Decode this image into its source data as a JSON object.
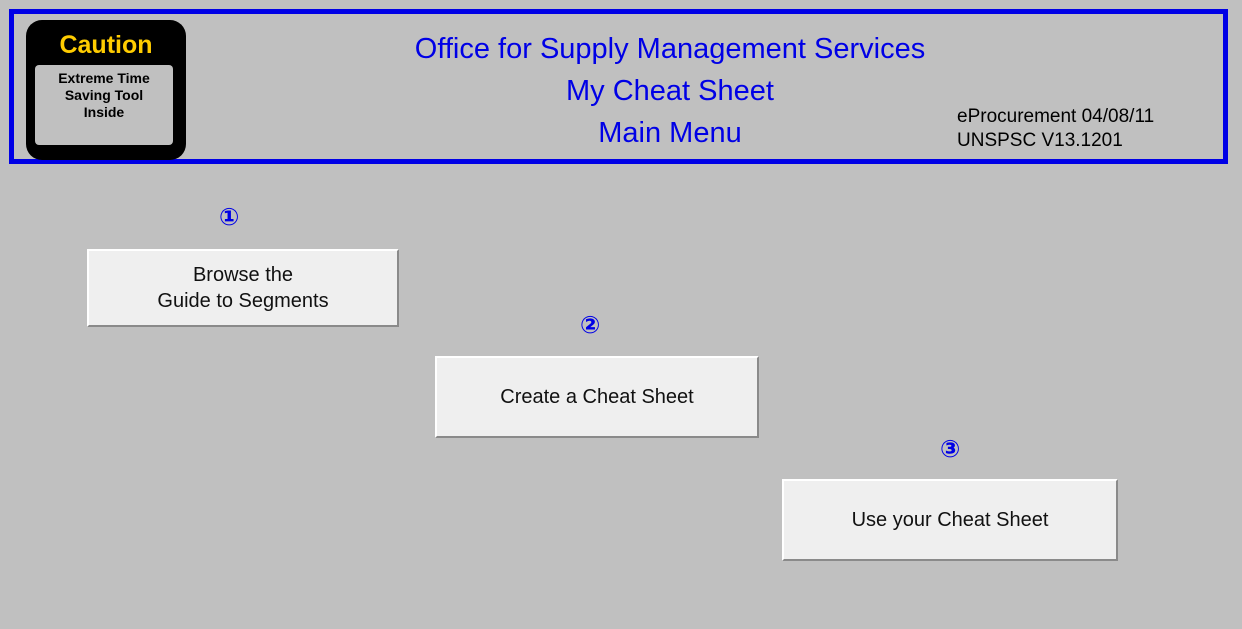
{
  "caution": {
    "title": "Caution",
    "line1": "Extreme Time",
    "line2": "Saving Tool",
    "line3": "Inside"
  },
  "header": {
    "title_line1": "Office for Supply  Management  Services",
    "title_line2": "My Cheat Sheet",
    "title_line3": "Main Menu",
    "version_line1": "eProcurement  04/08/11",
    "version_line2": "UNSPSC V13.1201"
  },
  "steps": [
    {
      "number": "①",
      "label_line1": "Browse the",
      "label_line2": "Guide to Segments"
    },
    {
      "number": "②",
      "label_line1": "Create a Cheat Sheet"
    },
    {
      "number": "③",
      "label_line1": "Use your Cheat Sheet"
    }
  ],
  "colors": {
    "background": "#c0c0c0",
    "accent_blue": "#0000e6",
    "caution_yellow": "#ffcc00",
    "button_face": "#efefef"
  }
}
